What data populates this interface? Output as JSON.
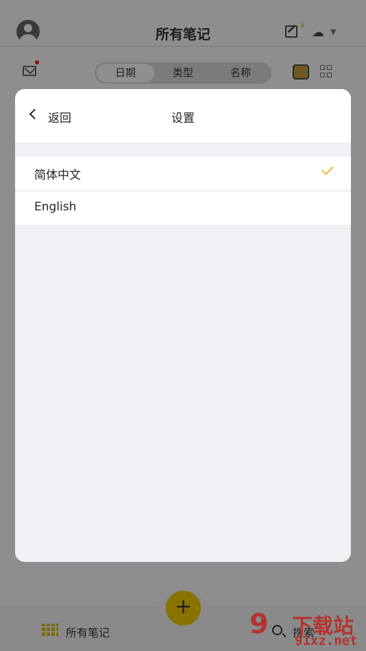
{
  "app": {
    "title": "所有笔记",
    "tabs": [
      {
        "label": "日期"
      },
      {
        "label": "类型"
      },
      {
        "label": "名称"
      }
    ],
    "bottom": {
      "all_notes": "所有笔记",
      "search": "搜索",
      "add_symbol": "+"
    },
    "icons": {
      "avatar": "avatar-icon",
      "edit": "edit-icon",
      "cloud": "cloud-upload-icon",
      "mail": "mail-icon",
      "shelf": "bookshelf-icon",
      "grid": "grid-view-icon"
    }
  },
  "dialog": {
    "back_label": "返回",
    "title": "设置",
    "languages": [
      {
        "label": "简体中文",
        "selected": true
      },
      {
        "label": "English",
        "selected": false
      }
    ]
  },
  "watermark": {
    "logo": "9",
    "text": "下载站",
    "url": "91xz.net"
  },
  "colors": {
    "accent": "#e6b830",
    "overlay": "#8e8e8e",
    "dialog_bg": "#f1f0f5",
    "watermark": "#b5332e"
  }
}
